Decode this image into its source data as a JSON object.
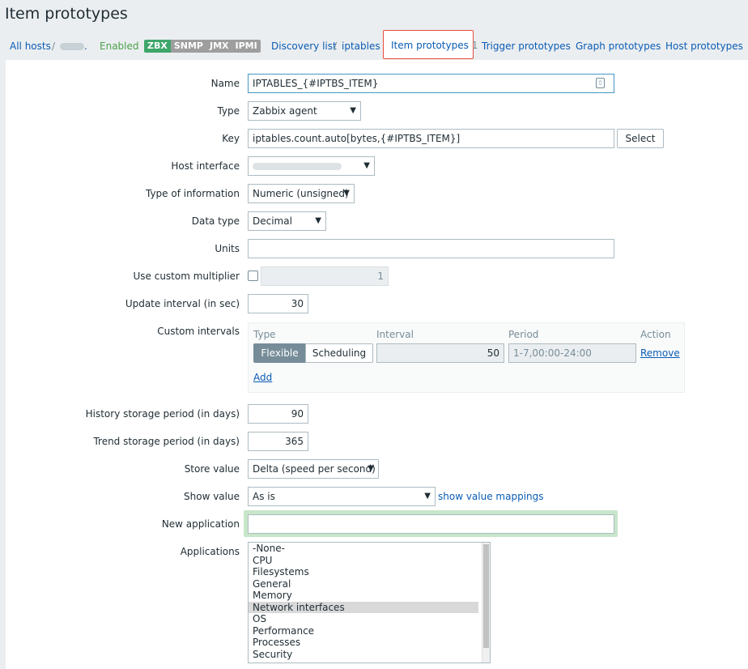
{
  "page": {
    "title": "Item prototypes"
  },
  "breadcrumbs": {
    "all_hosts": "All hosts",
    "slash1": "/",
    "host_suffix": ".",
    "status": "Enabled",
    "badges": [
      "ZBX",
      "SNMP",
      "JMX",
      "IPMI"
    ],
    "discovery_list": "Discovery list",
    "slash2": "/",
    "discovery_rule": "iptables",
    "item_prototypes": "Item prototypes",
    "item_prototypes_count": "1",
    "trigger_prototypes": "Trigger prototypes",
    "graph_prototypes": "Graph prototypes",
    "host_prototypes": "Host prototypes"
  },
  "form": {
    "name": {
      "label": "Name",
      "value": "IPTABLES_{#IPTBS_ITEM}"
    },
    "type": {
      "label": "Type",
      "value": "Zabbix agent"
    },
    "key": {
      "label": "Key",
      "value": "iptables.count.auto[bytes,{#IPTBS_ITEM}]",
      "button": "Select"
    },
    "host_interface": {
      "label": "Host interface"
    },
    "type_of_information": {
      "label": "Type of information",
      "value": "Numeric (unsigned)"
    },
    "data_type": {
      "label": "Data type",
      "value": "Decimal"
    },
    "units": {
      "label": "Units",
      "value": ""
    },
    "custom_multiplier": {
      "label": "Use custom multiplier",
      "checked": false,
      "value": "1"
    },
    "update_interval": {
      "label": "Update interval (in sec)",
      "value": "30"
    },
    "custom_intervals": {
      "label": "Custom intervals",
      "headers": {
        "type": "Type",
        "interval": "Interval",
        "period": "Period",
        "action": "Action"
      },
      "row": {
        "type_options": [
          "Flexible",
          "Scheduling"
        ],
        "selected_type": "Flexible",
        "interval": "50",
        "period": "1-7,00:00-24:00",
        "remove": "Remove"
      },
      "add": "Add"
    },
    "history": {
      "label": "History storage period (in days)",
      "value": "90"
    },
    "trends": {
      "label": "Trend storage period (in days)",
      "value": "365"
    },
    "store_value": {
      "label": "Store value",
      "value": "Delta (speed per second)"
    },
    "show_value": {
      "label": "Show value",
      "value": "As is",
      "link": "show value mappings"
    },
    "new_application": {
      "label": "New application",
      "value": ""
    },
    "applications": {
      "label": "Applications",
      "options": [
        "-None-",
        "CPU",
        "Filesystems",
        "General",
        "Memory",
        "Network interfaces",
        "OS",
        "Performance",
        "Processes",
        "Security"
      ],
      "selected": "Network interfaces"
    }
  },
  "colors": {
    "link": "#0a5cb5",
    "enabled": "#4aa24a",
    "zbx_badge": "#3fa66b",
    "inactive_badge": "#9e9e9e",
    "active_tab_border": "#e74c3c",
    "new_application_highlight": "#c8e6c9"
  }
}
